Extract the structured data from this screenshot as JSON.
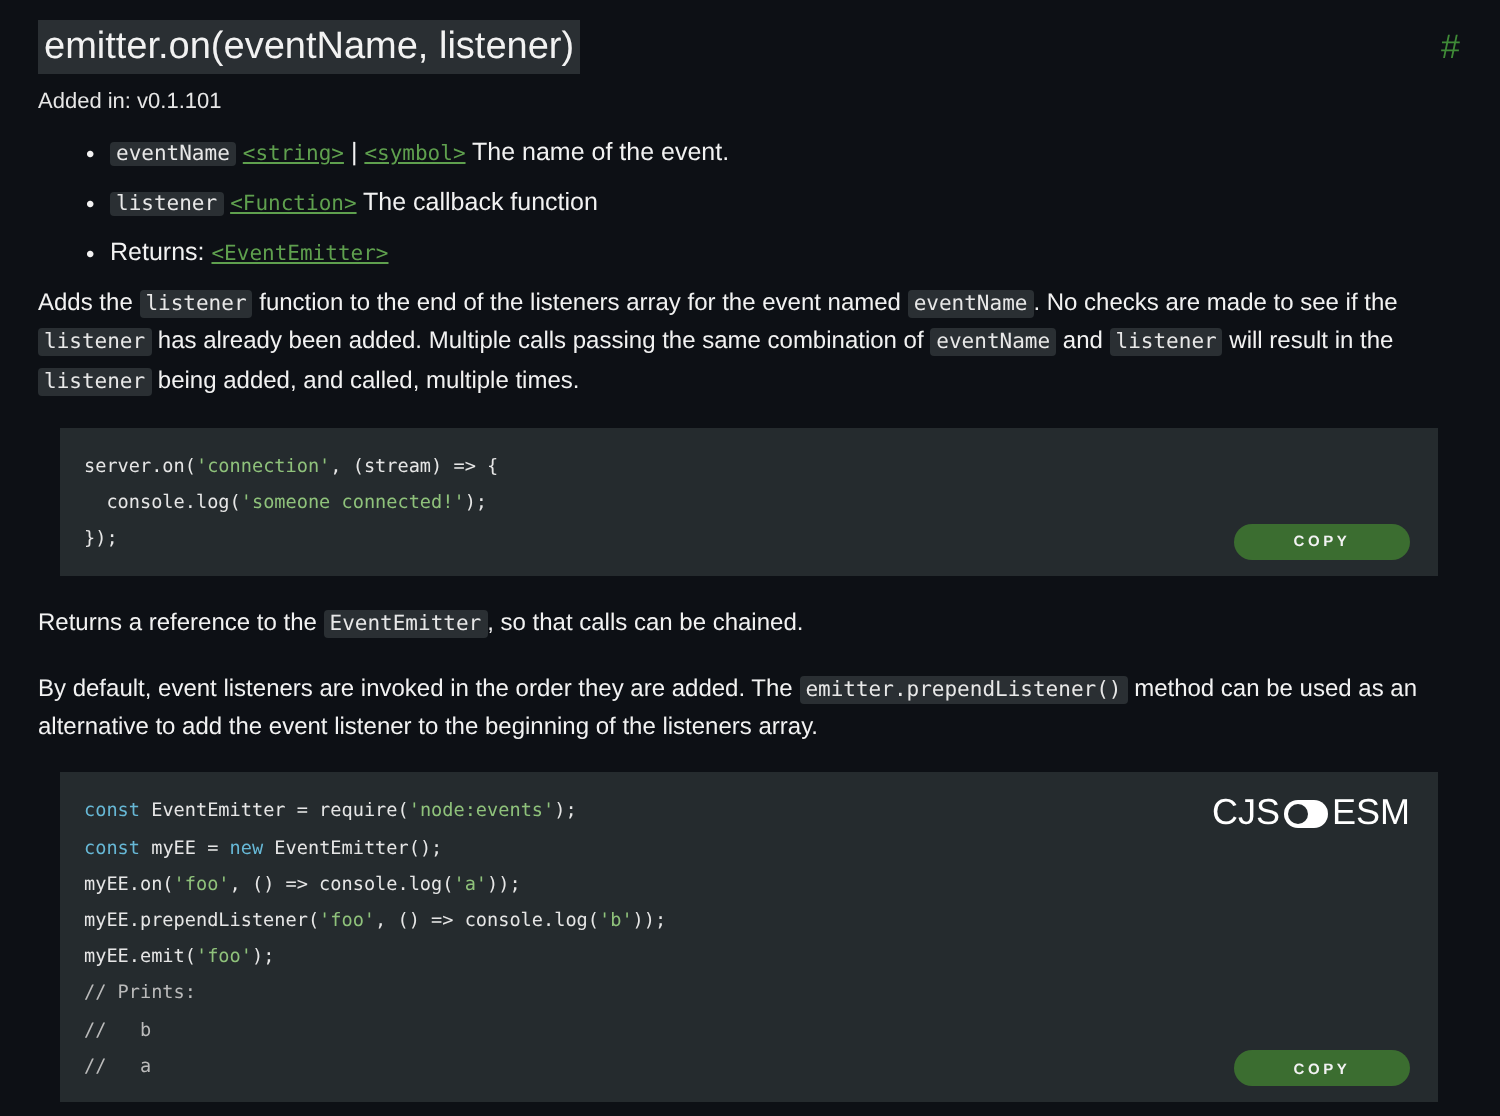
{
  "heading": {
    "title": "emitter.on(eventName, listener)",
    "anchor": "#"
  },
  "added_in": "Added in: v0.1.101",
  "params": [
    {
      "bullet": "•",
      "segments": [
        {
          "kind": "code",
          "text": "eventName"
        },
        {
          "kind": "link",
          "text": "<string>"
        },
        {
          "kind": "text",
          "text": "|"
        },
        {
          "kind": "link",
          "text": "<symbol>"
        },
        {
          "kind": "text",
          "text": "The name of the event."
        }
      ]
    },
    {
      "bullet": "•",
      "segments": [
        {
          "kind": "code",
          "text": "listener"
        },
        {
          "kind": "link",
          "text": "<Function>"
        },
        {
          "kind": "text",
          "text": "The callback function"
        }
      ]
    },
    {
      "bullet": "•",
      "segments": [
        {
          "kind": "text",
          "text": "Returns:"
        },
        {
          "kind": "link",
          "text": "<EventEmitter>"
        }
      ]
    }
  ],
  "content": [
    {
      "kind": "paragraph",
      "segments": [
        {
          "kind": "text",
          "text": "Adds the "
        },
        {
          "kind": "code",
          "text": "listener"
        },
        {
          "kind": "text",
          "text": " function to the end of the listeners array for the event named "
        },
        {
          "kind": "code",
          "text": "eventName"
        },
        {
          "kind": "text",
          "text": ". No checks are made to see if the "
        },
        {
          "kind": "code",
          "text": "listener"
        },
        {
          "kind": "text",
          "text": " has already been added. Multiple calls passing the same combination of "
        },
        {
          "kind": "code",
          "text": "eventName"
        },
        {
          "kind": "text",
          "text": " and "
        },
        {
          "kind": "code",
          "text": "listener"
        },
        {
          "kind": "text",
          "text": " will result in the "
        },
        {
          "kind": "code",
          "text": "listener"
        },
        {
          "kind": "text",
          "text": " being added, and called, multiple times."
        }
      ]
    },
    {
      "kind": "code_block",
      "copy_label": "COPY",
      "lines": [
        [
          {
            "kind": "plain",
            "text": "server.on("
          },
          {
            "kind": "string",
            "text": "'connection'"
          },
          {
            "kind": "plain",
            "text": ", (stream) => {"
          }
        ],
        [
          {
            "kind": "plain",
            "text": "  console.log("
          },
          {
            "kind": "string",
            "text": "'someone connected!'"
          },
          {
            "kind": "plain",
            "text": ");"
          }
        ],
        [
          {
            "kind": "plain",
            "text": "});"
          }
        ]
      ]
    },
    {
      "kind": "paragraph",
      "segments": [
        {
          "kind": "text",
          "text": "Returns a reference to the "
        },
        {
          "kind": "code",
          "text": "EventEmitter"
        },
        {
          "kind": "text",
          "text": ", so that calls can be chained."
        }
      ]
    },
    {
      "kind": "paragraph",
      "segments": [
        {
          "kind": "text",
          "text": "By default, event listeners are invoked in the order they are added. The "
        },
        {
          "kind": "code",
          "text": "emitter.prependListener()"
        },
        {
          "kind": "text",
          "text": " method can be used as an alternative to add the event listener to the beginning of the listeners array."
        }
      ]
    },
    {
      "kind": "code_block",
      "copy_label": "COPY",
      "module_toggle": {
        "off_label": "CJS",
        "on_label": "ESM",
        "on": false
      },
      "lines": [
        [
          {
            "kind": "keyword",
            "text": "const"
          },
          {
            "kind": "plain",
            "text": " EventEmitter = require("
          },
          {
            "kind": "string",
            "text": "'node:events'"
          },
          {
            "kind": "plain",
            "text": ");"
          }
        ],
        [
          {
            "kind": "keyword",
            "text": "const"
          },
          {
            "kind": "plain",
            "text": " myEE = "
          },
          {
            "kind": "keyword",
            "text": "new"
          },
          {
            "kind": "plain",
            "text": " EventEmitter();"
          }
        ],
        [
          {
            "kind": "plain",
            "text": "myEE.on("
          },
          {
            "kind": "string",
            "text": "'foo'"
          },
          {
            "kind": "plain",
            "text": ", () => console.log("
          },
          {
            "kind": "string",
            "text": "'a'"
          },
          {
            "kind": "plain",
            "text": "));"
          }
        ],
        [
          {
            "kind": "plain",
            "text": "myEE.prependListener("
          },
          {
            "kind": "string",
            "text": "'foo'"
          },
          {
            "kind": "plain",
            "text": ", () => console.log("
          },
          {
            "kind": "string",
            "text": "'b'"
          },
          {
            "kind": "plain",
            "text": "));"
          }
        ],
        [
          {
            "kind": "plain",
            "text": "myEE.emit("
          },
          {
            "kind": "string",
            "text": "'foo'"
          },
          {
            "kind": "plain",
            "text": ");"
          }
        ],
        [
          {
            "kind": "comment",
            "text": "// Prints:"
          }
        ],
        [
          {
            "kind": "comment",
            "text": "//   b"
          }
        ],
        [
          {
            "kind": "comment",
            "text": "//   a"
          }
        ]
      ]
    }
  ]
}
